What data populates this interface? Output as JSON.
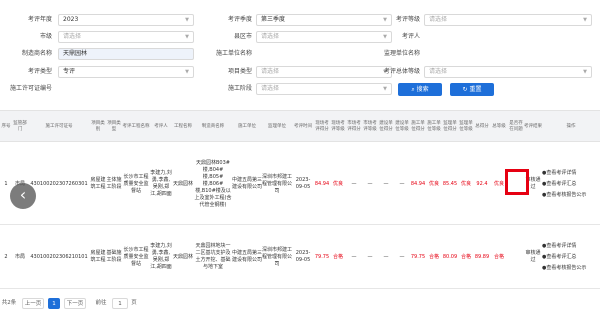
{
  "filters": {
    "row1": {
      "year_label": "考评年度",
      "year_value": "2023",
      "quarter_label": "考评季度",
      "quarter_value": "第三季度",
      "grade_label": "考评等级",
      "grade_value": "请选择"
    },
    "row2": {
      "city_label": "市级",
      "city_value": "请选择",
      "county_label": "县区市",
      "county_value": "请选择",
      "evaluator_label": "考评人",
      "evaluator_value": ""
    },
    "row3": {
      "company_label": "制造商名称",
      "company_value": "天鼎园林",
      "permit_label": "施工单位名称",
      "permit_value": "",
      "builder_label": "监理单位名称",
      "builder_value": ""
    },
    "row4": {
      "type_label": "考评类型",
      "type_value": "专评",
      "project_type_label": "项目类型",
      "project_type_value": "请选择",
      "score_grade_label": "考评总体等级",
      "score_grade_value": "请选择"
    },
    "row5": {
      "license_label": "施工许可证编号",
      "license_value": "",
      "stage_label": "施工阶段",
      "stage_value": "请选择",
      "search_label": "搜索",
      "reset_label": "重置"
    }
  },
  "table": {
    "headers": [
      "序号",
      "监管部门",
      "施工许可证号",
      "项目类别",
      "项目类型",
      "考评工程名称",
      "考评人",
      "工程名称",
      "制造商名称",
      "施工单位",
      "监理单位",
      "考评时间",
      "现场考评得分",
      "现场考评等级",
      "市场考评得分",
      "市场考评等级",
      "建设单位得分",
      "建设单位等级",
      "施工单位得分",
      "施工单位等级",
      "监理单位得分",
      "监理单位等级",
      "总得分",
      "总等级",
      "是否存在问题",
      "考评结果",
      "操作"
    ],
    "rows": [
      {
        "index": "1",
        "dept": "市局",
        "license": "430100202307260301",
        "category": "房屋建筑工程",
        "ptype": "主体施工阶段",
        "project": "长沙市工程质量安全监督站",
        "evaluator": "李建力,刘勇,李鑫,吴刚,郑江,胡四面",
        "work_name": "天鼎园林",
        "maker": "天鼎园林B03#楼,B04#楼,B05#楼,B06#楼,B10#楼及以上及室外工程(含代管全钢楼)",
        "constructor": "中建五局第三建设有限公司",
        "supervisor": "深圳市邦建工程管理有限公司",
        "date": "2023-09-05",
        "s1": "84.94",
        "g1": "优良",
        "s2": "—",
        "g2": "—",
        "s3": "—",
        "g3": "—",
        "s4": "84.94",
        "g4": "优良",
        "s5": "85.45",
        "g5": "优良",
        "s6": "92.4",
        "g6": "优良",
        "problem": "",
        "result": "审核通过",
        "actions": [
          "●查看考评详情",
          "●查看考评汇总",
          "●查看考核报告公示"
        ]
      },
      {
        "index": "2",
        "dept": "市局",
        "license": "430100202306210101",
        "category": "房屋建筑工程",
        "ptype": "基础施工阶段",
        "project": "长沙市工程质量安全监督站",
        "evaluator": "李建力,刘勇,李鑫,吴刚,郑江,胡四面",
        "work_name": "天鼎园林",
        "maker": "天鼎园林地块一二区基坑支护及土方开挖、基础与地下室",
        "constructor": "中建五局第三建设有限公司",
        "supervisor": "深圳市邦建工程管理有限公司",
        "date": "2023-09-05",
        "s1": "79.75",
        "g1": "合格",
        "s2": "—",
        "g2": "—",
        "s3": "—",
        "g3": "—",
        "s4": "79.75",
        "g4": "合格",
        "s5": "80.09",
        "g5": "合格",
        "s6": "89.89",
        "g6": "合格",
        "problem": "",
        "result": "审核通过",
        "actions": [
          "●查看考评详情",
          "●查看考评汇总",
          "●查看考核报告公示"
        ]
      }
    ]
  },
  "pager": {
    "total": "共2条",
    "prev": "上一页",
    "current": "1",
    "next": "下一页",
    "goto_label": "前往",
    "goto_value": "1",
    "page_suffix": "页"
  },
  "colors": {
    "accent": "#1e6fd9",
    "danger": "#e60012",
    "header_bg": "#f2f3f5"
  },
  "icons": {
    "prev_arrow": "chevron-left-icon"
  }
}
